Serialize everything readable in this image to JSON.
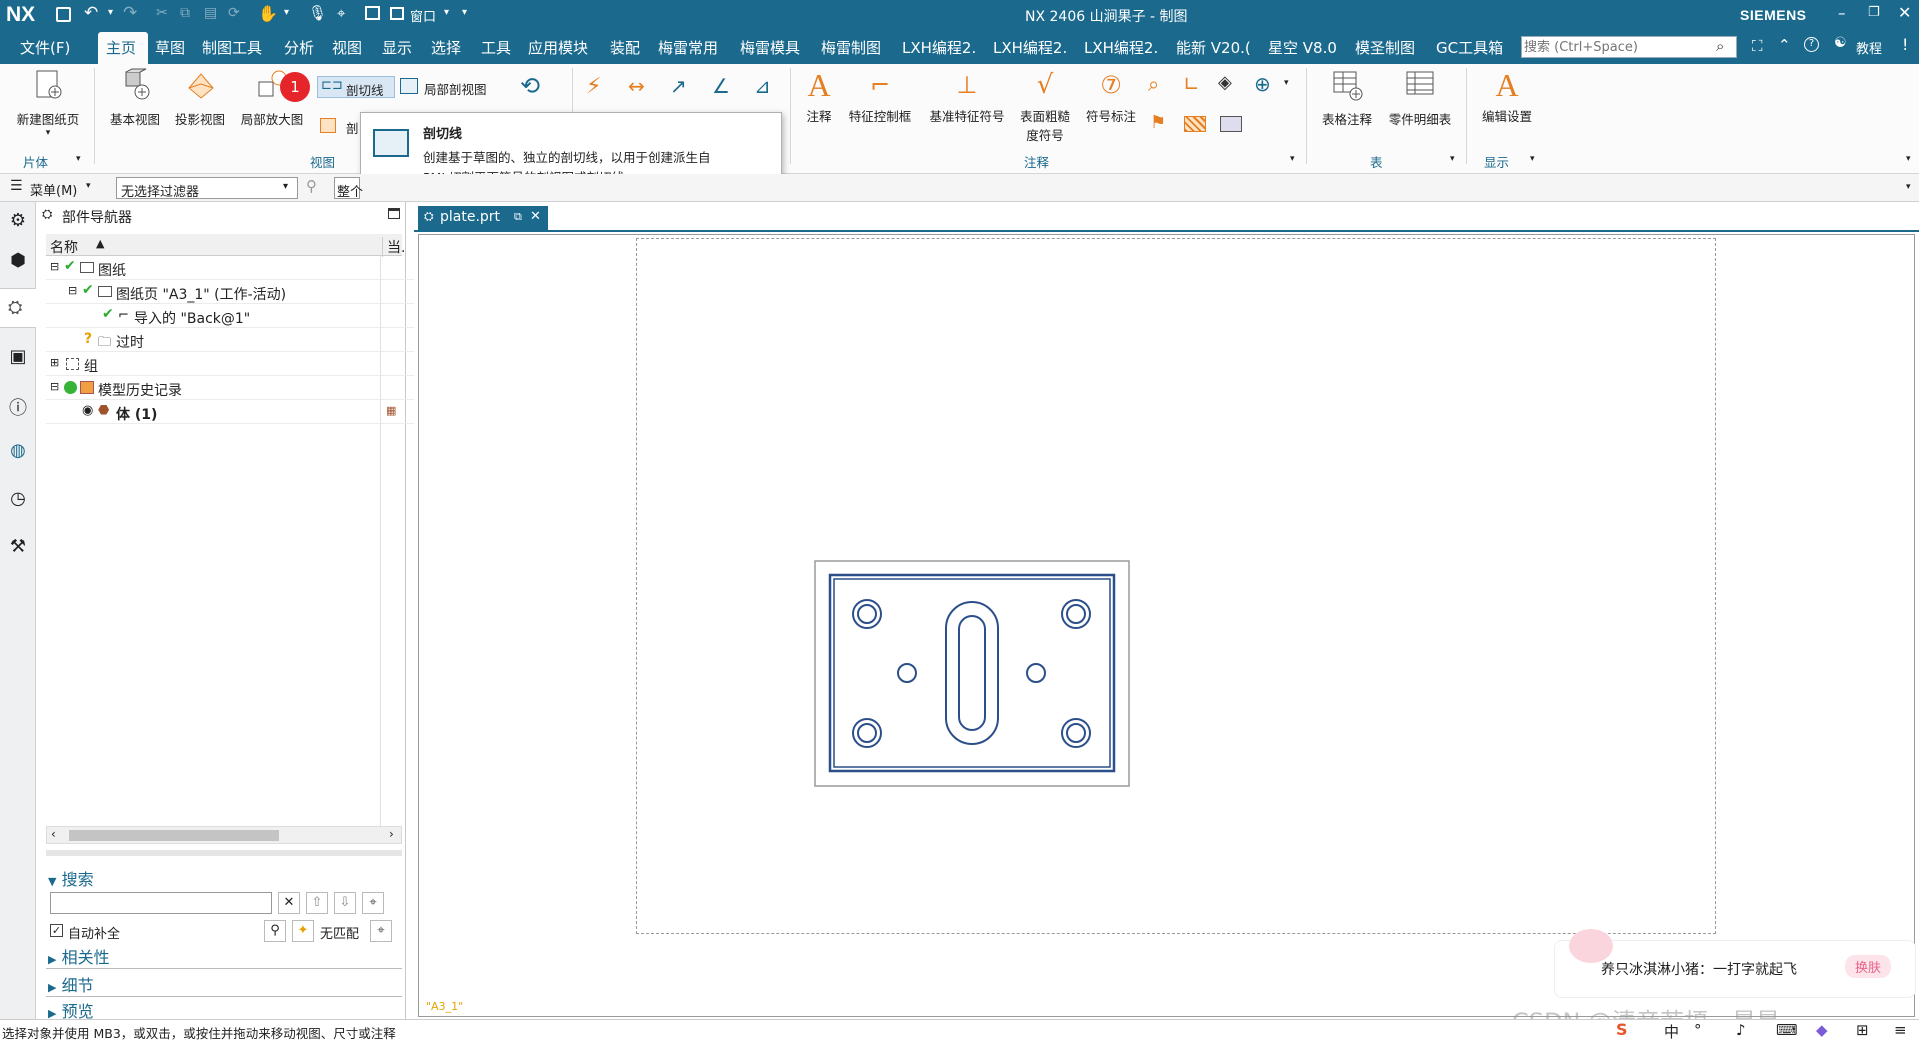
{
  "titlebar": {
    "logo": "NX",
    "window_menu": "窗口",
    "title": "NX 2406 山涧果子 - 制图",
    "brand": "SIEMENS"
  },
  "menubar": {
    "items": [
      "文件(F)",
      "主页",
      "草图",
      "制图工具",
      "分析",
      "视图",
      "显示",
      "选择",
      "工具",
      "应用模块",
      "装配",
      "梅雷常用",
      "梅雷模具",
      "梅雷制图",
      "LXH编程2.",
      "LXH编程2.",
      "LXH编程2.",
      "能新 V20.(",
      "星空 V8.0",
      "模圣制图",
      "GC工具箱"
    ],
    "search_placeholder": "搜索 (Ctrl+Space)",
    "tutorial": "教程"
  },
  "ribbon": {
    "new_sheet": "新建图纸页",
    "group_sheet": "片体",
    "base_view": "基本视图",
    "projected_view": "投影视图",
    "detail_view": "局部放大图",
    "section_line": "剖切线",
    "break_out_section": "局部剖视图",
    "partial_label": "剖",
    "group_view": "视图",
    "note": "注释",
    "fcf": "特征控制框",
    "datum_feature": "基准特征符号",
    "surface_finish_1": "表面粗糙",
    "surface_finish_2": "度符号",
    "id_symbol": "符号标注",
    "group_annotation": "注释",
    "tabular_note": "表格注释",
    "parts_list": "零件明细表",
    "group_table": "表",
    "edit_settings": "编辑设置",
    "group_display": "显示",
    "badge": "1"
  },
  "tooltip": {
    "title": "剖切线",
    "line1": "创建基于草图的、独立的剖切线，以用于创建派生自",
    "line2": "PMI 切割平面符号的剖视图或剖切线。"
  },
  "selbar": {
    "menu": "菜单(M)",
    "filter": "无选择过滤器",
    "scope": "整个"
  },
  "navigator": {
    "title": "部件导航器",
    "col_name": "名称",
    "col_current": "当.",
    "rows": [
      {
        "label": "图纸"
      },
      {
        "label": "图纸页 \"A3_1\" (工作-活动)"
      },
      {
        "label": "导入的 \"Back@1\""
      },
      {
        "label": "过时"
      },
      {
        "label": "组"
      },
      {
        "label": "模型历史记录"
      },
      {
        "label": "体 (1)"
      }
    ],
    "search_title": "搜索",
    "autocomplete": "自动补全",
    "no_match": "无匹配",
    "dependencies": "相关性",
    "details": "细节",
    "preview": "预览"
  },
  "document": {
    "tab": "plate.prt",
    "sheet_label": "\"A3_1\""
  },
  "status": {
    "text": "选择对象并使用 MB3，或双击，或按住并拖动来移动视图、尺寸或注释"
  },
  "popup": {
    "text": "养只冰淇淋小猪：一打字就起飞",
    "skin": "换肤",
    "watermark": "CSDN @清音若榎一昙昙"
  },
  "colors": {
    "nx_blue": "#1b6a8e",
    "drawing_line": "#2b4f8a",
    "badge_red": "#e5252a",
    "accent_orange": "#e67e22"
  }
}
